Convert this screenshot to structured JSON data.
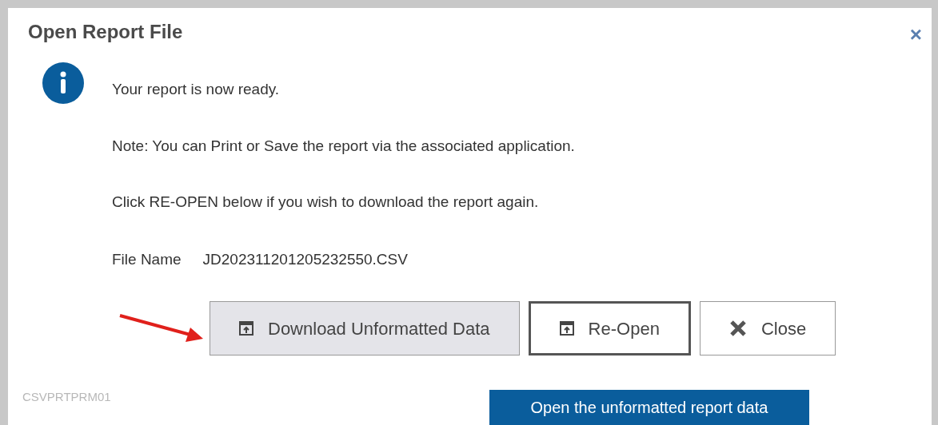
{
  "dialog": {
    "title": "Open Report File",
    "close_glyph": "×"
  },
  "messages": [
    "Your report is now ready.",
    "Note: You can Print or Save the report via the associated application.",
    "Click RE-OPEN below if you wish to download the report again."
  ],
  "file": {
    "label": "File Name",
    "value": "JD202311201205232550.CSV"
  },
  "buttons": [
    {
      "kind": "open",
      "label": "Download Unformatted Data",
      "hovered": true,
      "focused": false
    },
    {
      "kind": "open",
      "label": "Re-Open",
      "hovered": false,
      "focused": true
    },
    {
      "kind": "close",
      "label": "Close",
      "hovered": false,
      "focused": false
    }
  ],
  "screen_code": "CSVPRTPRM01",
  "tooltip": "Open the unformatted report data"
}
